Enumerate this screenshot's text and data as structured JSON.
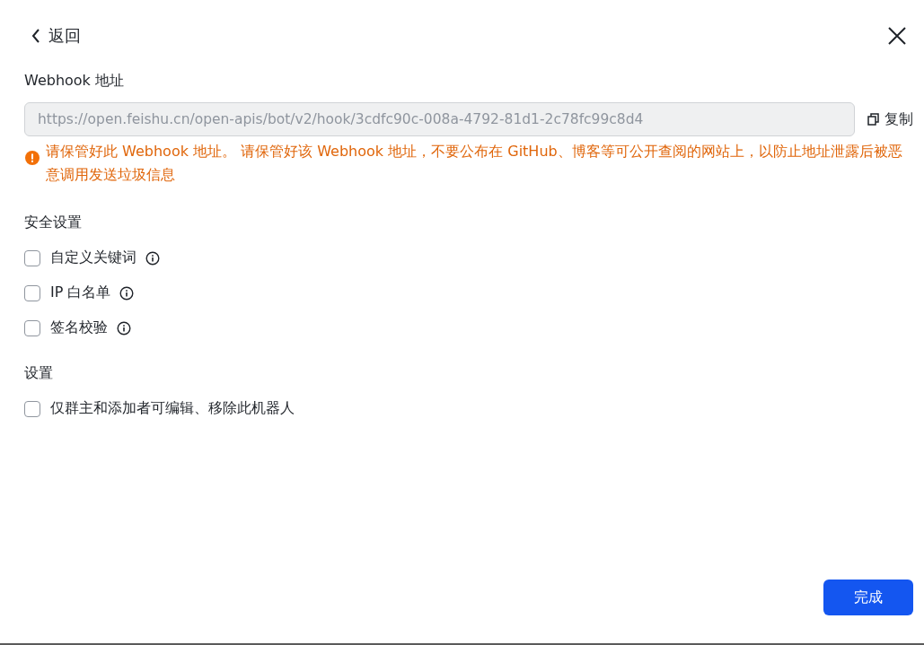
{
  "header": {
    "back": "返回"
  },
  "webhook": {
    "label": "Webhook 地址",
    "value": "https://open.feishu.cn/open-apis/bot/v2/hook/3cdfc90c-008a-4792-81d1-2c78fc99c8d4",
    "copy": "复制",
    "warning": "请保管好此 Webhook 地址。 请保管好该 Webhook 地址，不要公布在 GitHub、博客等可公开查阅的网站上，以防止地址泄露后被恶意调用发送垃圾信息"
  },
  "sections": [
    {
      "title": "安全设置",
      "options": [
        {
          "label": "自定义关键词",
          "checked": false,
          "info": true
        },
        {
          "label": "IP 白名单",
          "checked": false,
          "info": true
        },
        {
          "label": "签名校验",
          "checked": false,
          "info": true
        }
      ]
    },
    {
      "title": "设置",
      "options": [
        {
          "label": "仅群主和添加者可编辑、移除此机器人",
          "checked": false,
          "info": false
        }
      ]
    }
  ],
  "done": "完成"
}
